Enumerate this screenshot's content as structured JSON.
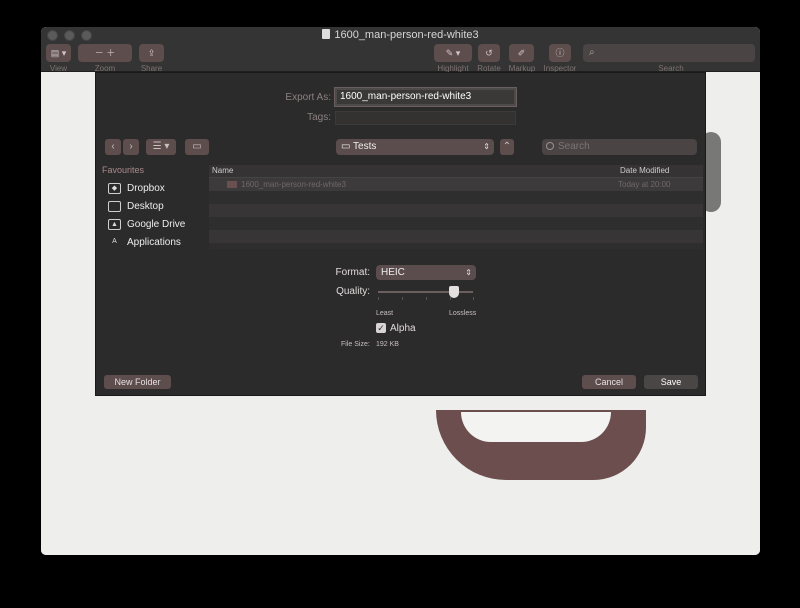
{
  "window": {
    "title": "1600_man-person-red-white3"
  },
  "toolbar": {
    "view_label": "View",
    "zoom_label": "Zoom",
    "share_label": "Share",
    "highlight_label": "Highlight",
    "rotate_label": "Rotate",
    "markup_label": "Markup",
    "inspector_label": "Inspector",
    "search_label": "Search"
  },
  "dialog": {
    "export_as_label": "Export As:",
    "export_as_value": "1600_man-person-red-white3",
    "tags_label": "Tags:",
    "tags_value": "",
    "location": "Tests",
    "search_placeholder": "Search",
    "sidebar": {
      "header": "Favourites",
      "items": [
        {
          "label": "Dropbox",
          "icon": "dropbox-icon"
        },
        {
          "label": "Desktop",
          "icon": "desktop-icon"
        },
        {
          "label": "Google Drive",
          "icon": "google-drive-icon"
        },
        {
          "label": "Applications",
          "icon": "applications-icon"
        }
      ]
    },
    "file_list": {
      "columns": [
        "Name",
        "Date Modified"
      ],
      "rows": [
        {
          "name": "1600_man-person-red-white3",
          "date": "Today at 20:00"
        }
      ]
    },
    "format_label": "Format:",
    "format_value": "HEIC",
    "quality_label": "Quality:",
    "quality_min_label": "Least",
    "quality_max_label": "Lossless",
    "quality_value": 0.8,
    "alpha_label": "Alpha",
    "alpha_checked": true,
    "file_size_label": "File Size:",
    "file_size_value": "192 KB",
    "new_folder_label": "New Folder",
    "cancel_label": "Cancel",
    "save_label": "Save"
  }
}
